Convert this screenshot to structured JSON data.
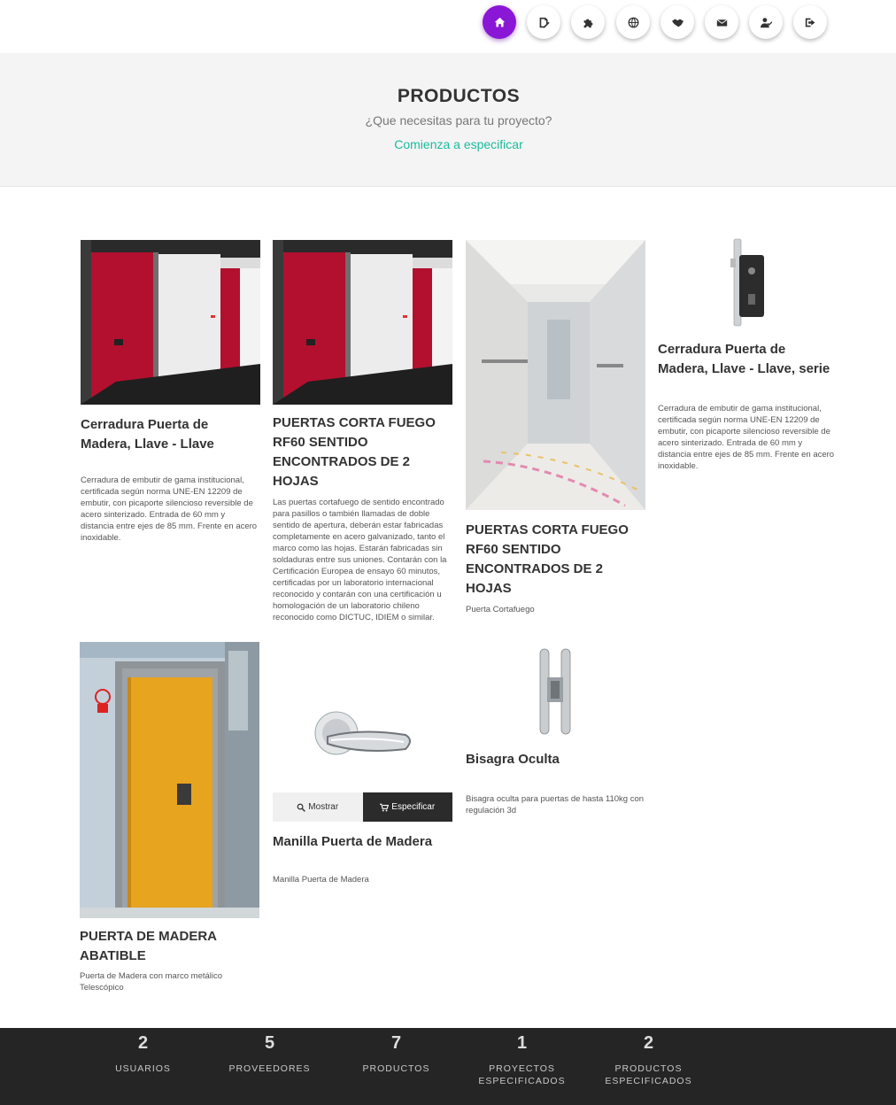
{
  "nav": {
    "items": [
      {
        "icon": "home-icon",
        "active": true
      },
      {
        "icon": "edit-document-icon",
        "active": false
      },
      {
        "icon": "puzzle-icon",
        "active": false
      },
      {
        "icon": "globe-icon",
        "active": false
      },
      {
        "icon": "handshake-icon",
        "active": false
      },
      {
        "icon": "envelope-icon",
        "active": false
      },
      {
        "icon": "user-check-icon",
        "active": false
      },
      {
        "icon": "sign-out-icon",
        "active": false
      }
    ],
    "accent_color": "#8a17d6"
  },
  "hero": {
    "title": "PRODUCTOS",
    "subtitle": "¿Que necesitas para tu proyecto?",
    "cta": "Comienza a especificar",
    "cta_color": "#1abc9c"
  },
  "products": [
    {
      "title": "Cerradura Puerta de Madera, Llave - Llave",
      "description": "Cerradura de embutir de gama institucional, certificada según norma UNE-EN 12209 de embutir, con picaporte silencioso reversible de acero sinterizado. Entrada de 60 mm y distancia entre ejes de 85 mm. Frente en acero inoxidable."
    },
    {
      "title": "PUERTAS CORTA FUEGO RF60 SENTIDO ENCONTRADOS DE 2 HOJAS",
      "description": "Las puertas cortafuego de sentido encontrado para pasillos o también llamadas de doble sentido de apertura, deberán estar fabricadas completamente en acero galvanizado, tanto el marco como las hojas. Estarán fabricadas sin soldaduras entre sus uniones. Contarán con la Certificación Europea de ensayo 60 minutos, certificadas por un laboratorio internacional reconocido y contarán con una certificación u homologación de un laboratorio chileno reconocido como DICTUC, IDIEM o similar."
    },
    {
      "title": "PUERTAS CORTA FUEGO RF60 SENTIDO ENCONTRADOS DE 2 HOJAS",
      "description": "Puerta Cortafuego"
    },
    {
      "title": "Cerradura Puerta de Madera, Llave - Llave, serie",
      "description": "Cerradura de embutir de gama institucional, certificada según norma UNE-EN 12209 de embutir, con picaporte silencioso reversible de acero sinterizado. Entrada de 60 mm y distancia entre ejes de 85 mm. Frente en acero inoxidable."
    },
    {
      "title": "PUERTA DE MADERA ABATIBLE",
      "description": "Puerta de Madera con marco metálico Telescópico"
    },
    {
      "title": "Manilla Puerta de Madera",
      "description": "Manilla Puerta de Madera",
      "show_label": "Mostrar",
      "specify_label": "Especificar"
    },
    {
      "title": "Bisagra Oculta",
      "description": "Bisagra oculta para puertas de hasta 110kg con regulación 3d"
    }
  ],
  "stats": [
    {
      "value": "2",
      "label": "USUARIOS"
    },
    {
      "value": "5",
      "label": "PROVEEDORES"
    },
    {
      "value": "7",
      "label": "PRODUCTOS"
    },
    {
      "value": "1",
      "label": "PROYECTOS ESPECIFICADOS"
    },
    {
      "value": "2",
      "label": "PRODUCTOS ESPECIFICADOS"
    }
  ]
}
